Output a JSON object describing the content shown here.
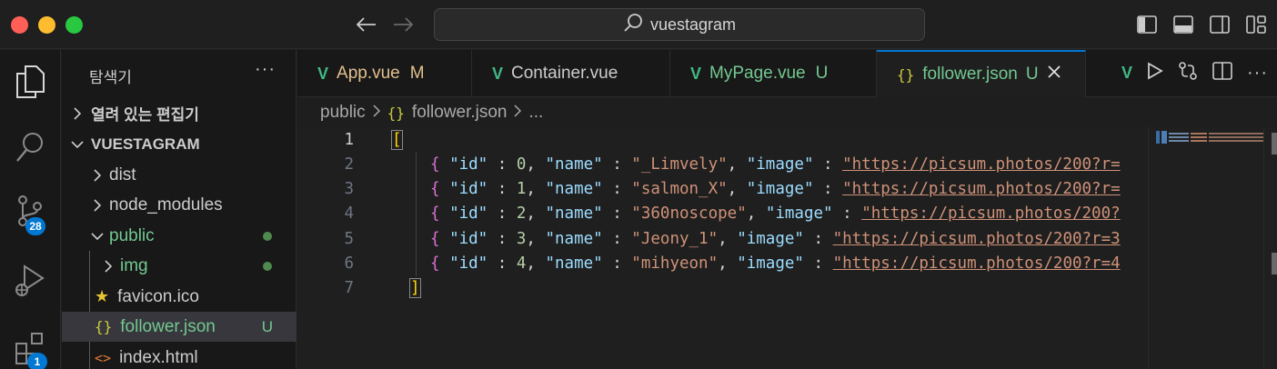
{
  "search": {
    "text": "vuestagram"
  },
  "activity_badges": {
    "source_control": "28",
    "extensions": "1"
  },
  "sidebar": {
    "title": "탐색기",
    "more": "···",
    "items": [
      {
        "label": "열려 있는 편집기",
        "chevron": "right"
      },
      {
        "label": "VUESTAGRAM",
        "chevron": "down"
      },
      {
        "label": "dist",
        "chevron": "right"
      },
      {
        "label": "node_modules",
        "chevron": "right"
      },
      {
        "label": "public",
        "chevron": "down"
      },
      {
        "label": "img",
        "chevron": "right"
      },
      {
        "label": "favicon.ico"
      },
      {
        "label": "follower.json",
        "status": "U"
      },
      {
        "label": "index.html"
      }
    ]
  },
  "tabs": [
    {
      "label": "App.vue",
      "status": "M"
    },
    {
      "label": "Container.vue",
      "status": ""
    },
    {
      "label": "MyPage.vue",
      "status": "U"
    },
    {
      "label": "follower.json",
      "status": "U",
      "active": true
    }
  ],
  "breadcrumb": {
    "folder": "public",
    "file": "follower.json",
    "more": "..."
  },
  "editor": {
    "line_numbers": [
      "1",
      "2",
      "3",
      "4",
      "5",
      "6",
      "7"
    ],
    "rows": [
      {
        "id": "0",
        "name": "\"_Limvely\"",
        "url": "\"https://picsum.photos/200?r="
      },
      {
        "id": "1",
        "name": "\"salmon_X\"",
        "url": "\"https://picsum.photos/200?r="
      },
      {
        "id": "2",
        "name": "\"360noscope\"",
        "url": "\"https://picsum.photos/200?"
      },
      {
        "id": "3",
        "name": "\"Jeony_1\"",
        "url": "\"https://picsum.photos/200?r=3"
      },
      {
        "id": "4",
        "name": "\"mihyeon\"",
        "url": "\"https://picsum.photos/200?r=4"
      }
    ],
    "keys": {
      "id": "\"id\"",
      "name": "\"name\"",
      "image": "\"image\""
    },
    "open_bracket": "[",
    "close_bracket": "]"
  },
  "colors": {
    "accent": "#0078d4",
    "vue": "#41b883",
    "untracked": "#73c991",
    "modified": "#e2c08d"
  }
}
